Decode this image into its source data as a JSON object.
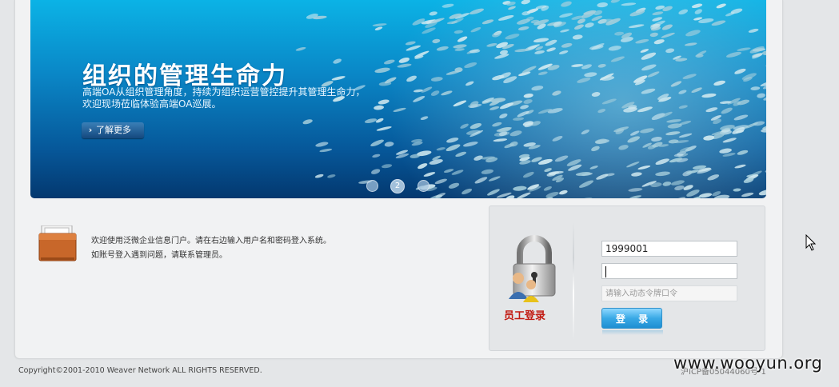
{
  "banner": {
    "title": "组织的管理生命力",
    "desc_line1": "高端OA从组织管理角度，持续为组织运营管控提升其管理生命力，",
    "desc_line2": "欢迎现场莅临体验高端OA巡展。",
    "more_label": "了解更多",
    "slides": [
      "",
      "2",
      ""
    ],
    "active_slide": 2
  },
  "welcome": {
    "line1": "欢迎使用泛微企业信息门户。请在右边输入用户名和密码登入系统。",
    "line2": "如账号登入遇到问题，请联系管理员。"
  },
  "login": {
    "title": "员工登录",
    "username_value": "1999001",
    "password_value": "",
    "token_placeholder": "请输入动态令牌口令",
    "submit_label": "登 录"
  },
  "footer": {
    "copyright": "Copyright©2001-2010 Weaver Network ALL RIGHTS RESERVED.",
    "icp": "沪ICP备05044060号-1"
  },
  "watermark": "www.wooyun.org",
  "icons": [
    "chevron-right-icon",
    "briefcase-icon",
    "lock-users-icon",
    "mouse-pointer-icon"
  ],
  "colors": {
    "banner_top": "#0bb3e6",
    "banner_bottom": "#04386f",
    "login_title": "#c21a12",
    "login_button": "#39a9e6"
  }
}
